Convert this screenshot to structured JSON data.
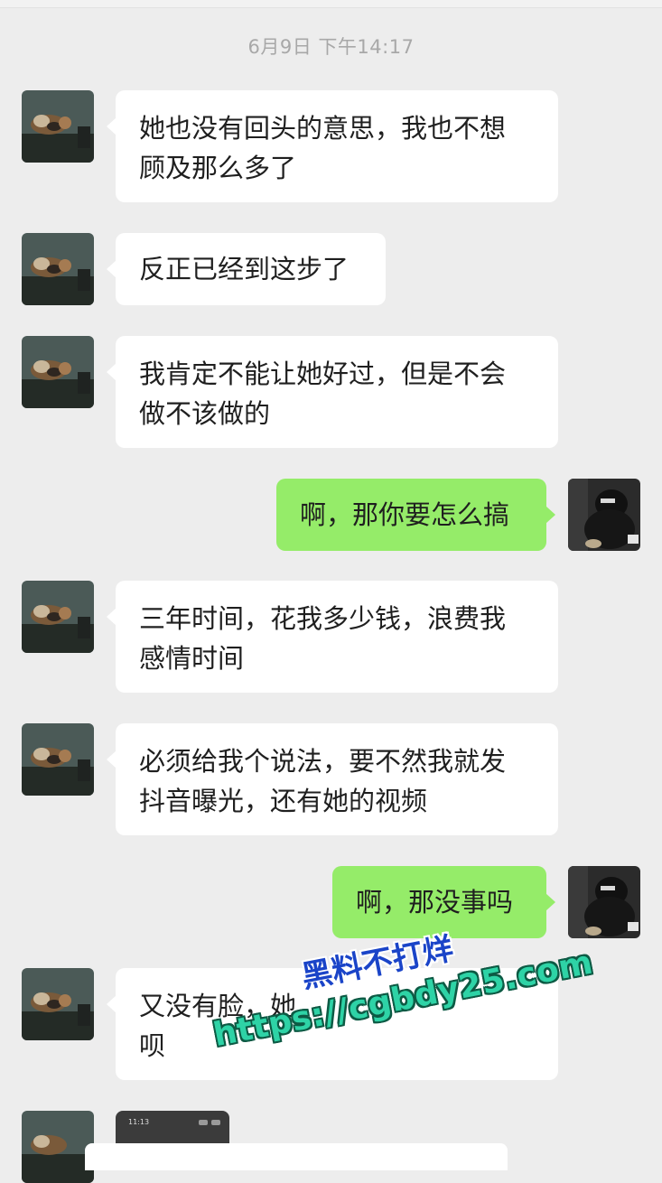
{
  "header": {
    "timestamp": "6月9日 下午14:17"
  },
  "messages": [
    {
      "side": "left",
      "lines": [
        "她也没有回头的意思，我也不想",
        "顾及那么多了"
      ]
    },
    {
      "side": "left",
      "lines": [
        "反正已经到这步了"
      ]
    },
    {
      "side": "left",
      "lines": [
        "我肯定不能让她好过，但是不会",
        "做不该做的"
      ]
    },
    {
      "side": "right",
      "lines": [
        "啊，那你要怎么搞"
      ]
    },
    {
      "side": "left",
      "lines": [
        "三年时间，花我多少钱，浪费我",
        "感情时间"
      ]
    },
    {
      "side": "left",
      "lines": [
        "必须给我个说法，要不然我就发",
        "抖音曝光，还有她的视频"
      ]
    },
    {
      "side": "right",
      "lines": [
        "啊，那没事吗"
      ]
    },
    {
      "side": "left",
      "lines": [
        "又没有脸，她",
        "呗"
      ]
    }
  ],
  "image_message": {
    "time_text": "11:13"
  },
  "watermark": {
    "title": "黑料不打烊",
    "url": "https://cgbdy25.com"
  },
  "colors": {
    "background": "#ededed",
    "bubble_incoming": "#ffffff",
    "bubble_outgoing": "#95ec69",
    "timestamp_text": "#a8a8a8"
  },
  "icons": {
    "contact_avatar": "cat-avatar-icon",
    "self_avatar": "hooded-person-avatar-icon"
  }
}
